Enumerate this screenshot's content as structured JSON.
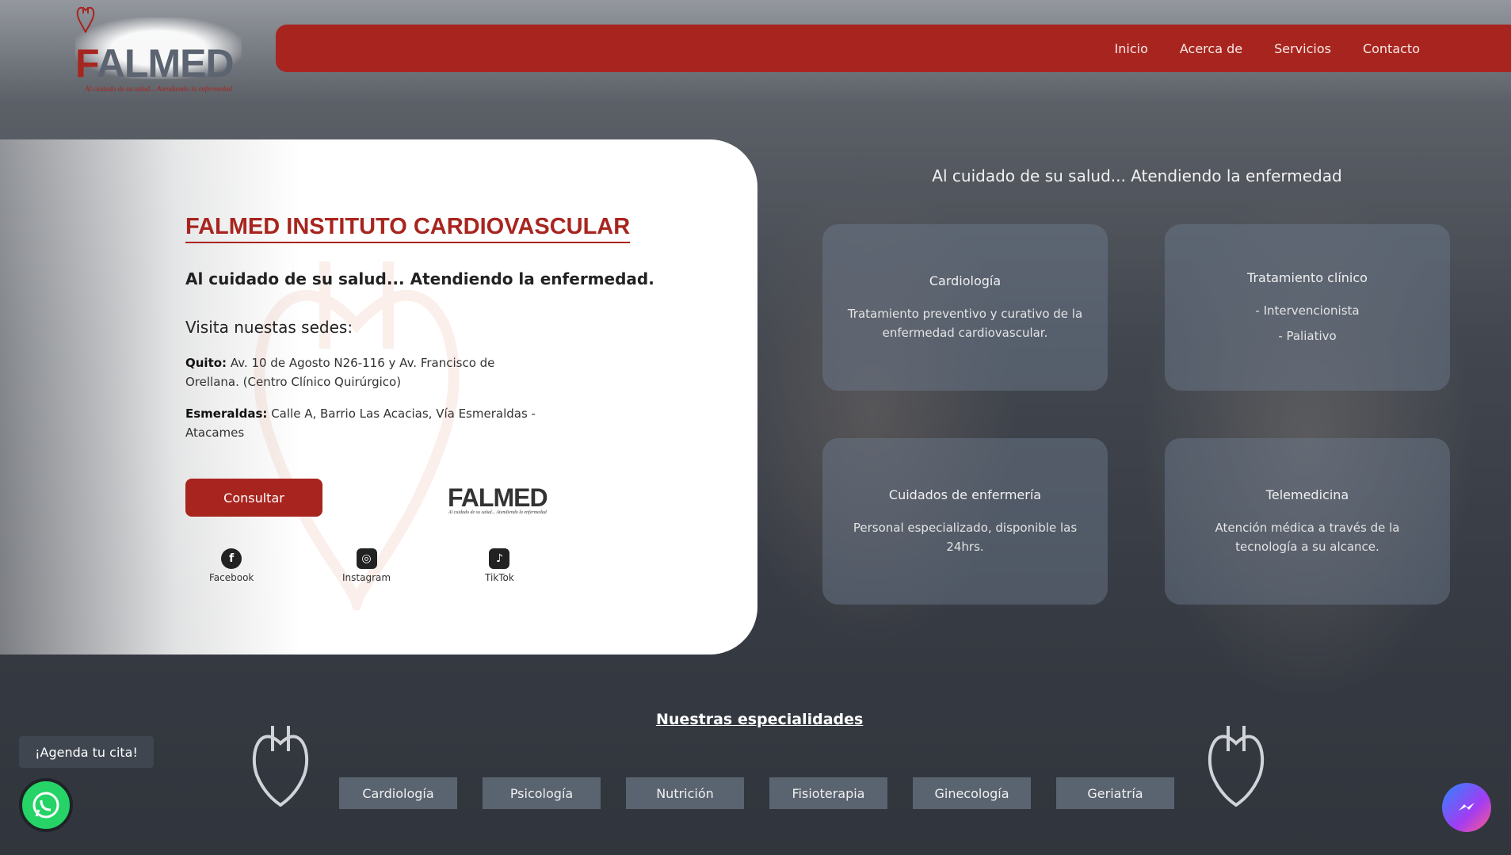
{
  "logo": {
    "f": "F",
    "rest": "ALMED",
    "tagline": "Al cuidado de su salud... Atendiendo la enfermedad"
  },
  "nav": {
    "items": [
      "Inicio",
      "Acerca de",
      "Servicios",
      "Contacto"
    ]
  },
  "hero": {
    "title": "FALMED INSTITUTO CARDIOVASCULAR",
    "subtitle": "Al cuidado de su salud... Atendiendo la enfermedad.",
    "visit": "Visita nuestas sedes:",
    "quito_label": "Quito:",
    "quito_text": " Av. 10 de Agosto N26-116 y Av. Francisco de Orellana. (Centro Clínico Quirúrgico)",
    "esmeraldas_label": "Esmeraldas:",
    "esmeraldas_text": " Calle A, Barrio Las Acacias, Vía Esmeraldas - Atacames",
    "consult_label": "Consultar",
    "small_logo_f": "F",
    "small_logo_rest": "ALMED",
    "small_logo_tag": "Al cuidado de su salud... Atendiendo la enfermedad"
  },
  "social": [
    {
      "label": "Facebook",
      "icon": "facebook-icon",
      "glyph": "f"
    },
    {
      "label": "Instagram",
      "icon": "instagram-icon",
      "glyph": "◎"
    },
    {
      "label": "TikTok",
      "icon": "tiktok-icon",
      "glyph": "♪"
    }
  ],
  "services": {
    "heading": "Al cuidado de su salud... Atendiendo la enfermedad",
    "cards": [
      {
        "title": "Cardiología",
        "desc": "Tratamiento preventivo y curativo de la enfermedad cardiovascular."
      },
      {
        "title": "Tratamiento clínico",
        "desc": "- Intervencionista",
        "desc2": "- Paliativo"
      },
      {
        "title": "Cuidados de enfermería",
        "desc": "Personal especializado, disponible las 24hrs."
      },
      {
        "title": "Telemedicina",
        "desc": "Atención médica a través de la tecnología a su alcance."
      }
    ]
  },
  "specialties": {
    "title": "Nuestras especialidades",
    "items": [
      "Cardiología",
      "Psicología",
      "Nutrición",
      "Fisioterapia",
      "Ginecología",
      "Geriatría"
    ]
  },
  "widgets": {
    "agenda": "¡Agenda tu cita!"
  },
  "colors": {
    "brand": "#a8251f",
    "gray": "#5b6470"
  }
}
